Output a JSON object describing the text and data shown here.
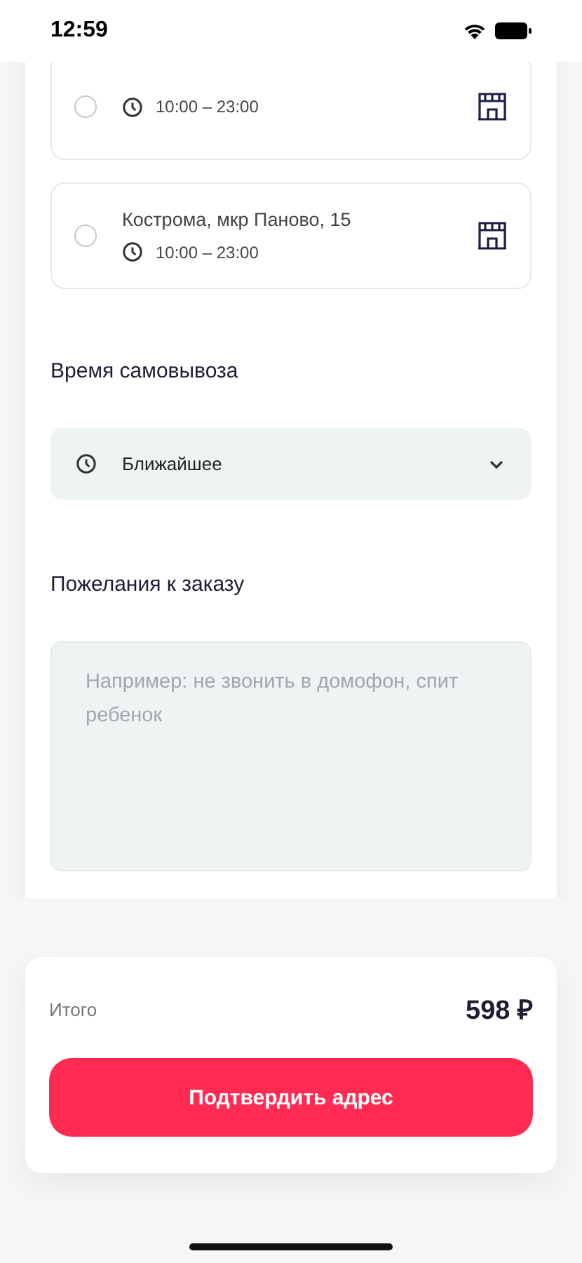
{
  "status_bar": {
    "time": "12:59"
  },
  "stores": [
    {
      "selected": false,
      "hours": "10:00 – 23:00"
    },
    {
      "selected": false,
      "address": "Кострома, мкр Паново, 15",
      "hours": "10:00 – 23:00"
    }
  ],
  "pickup_time": {
    "label": "Время самовывоза",
    "value": "Ближайшее"
  },
  "comment": {
    "label": "Пожелания к заказу",
    "placeholder": "Например: не звонить в домофон, спит ребенок"
  },
  "total": {
    "label": "Итого",
    "amount": "598 ₽"
  },
  "confirm_button": "Подтвердить адрес"
}
